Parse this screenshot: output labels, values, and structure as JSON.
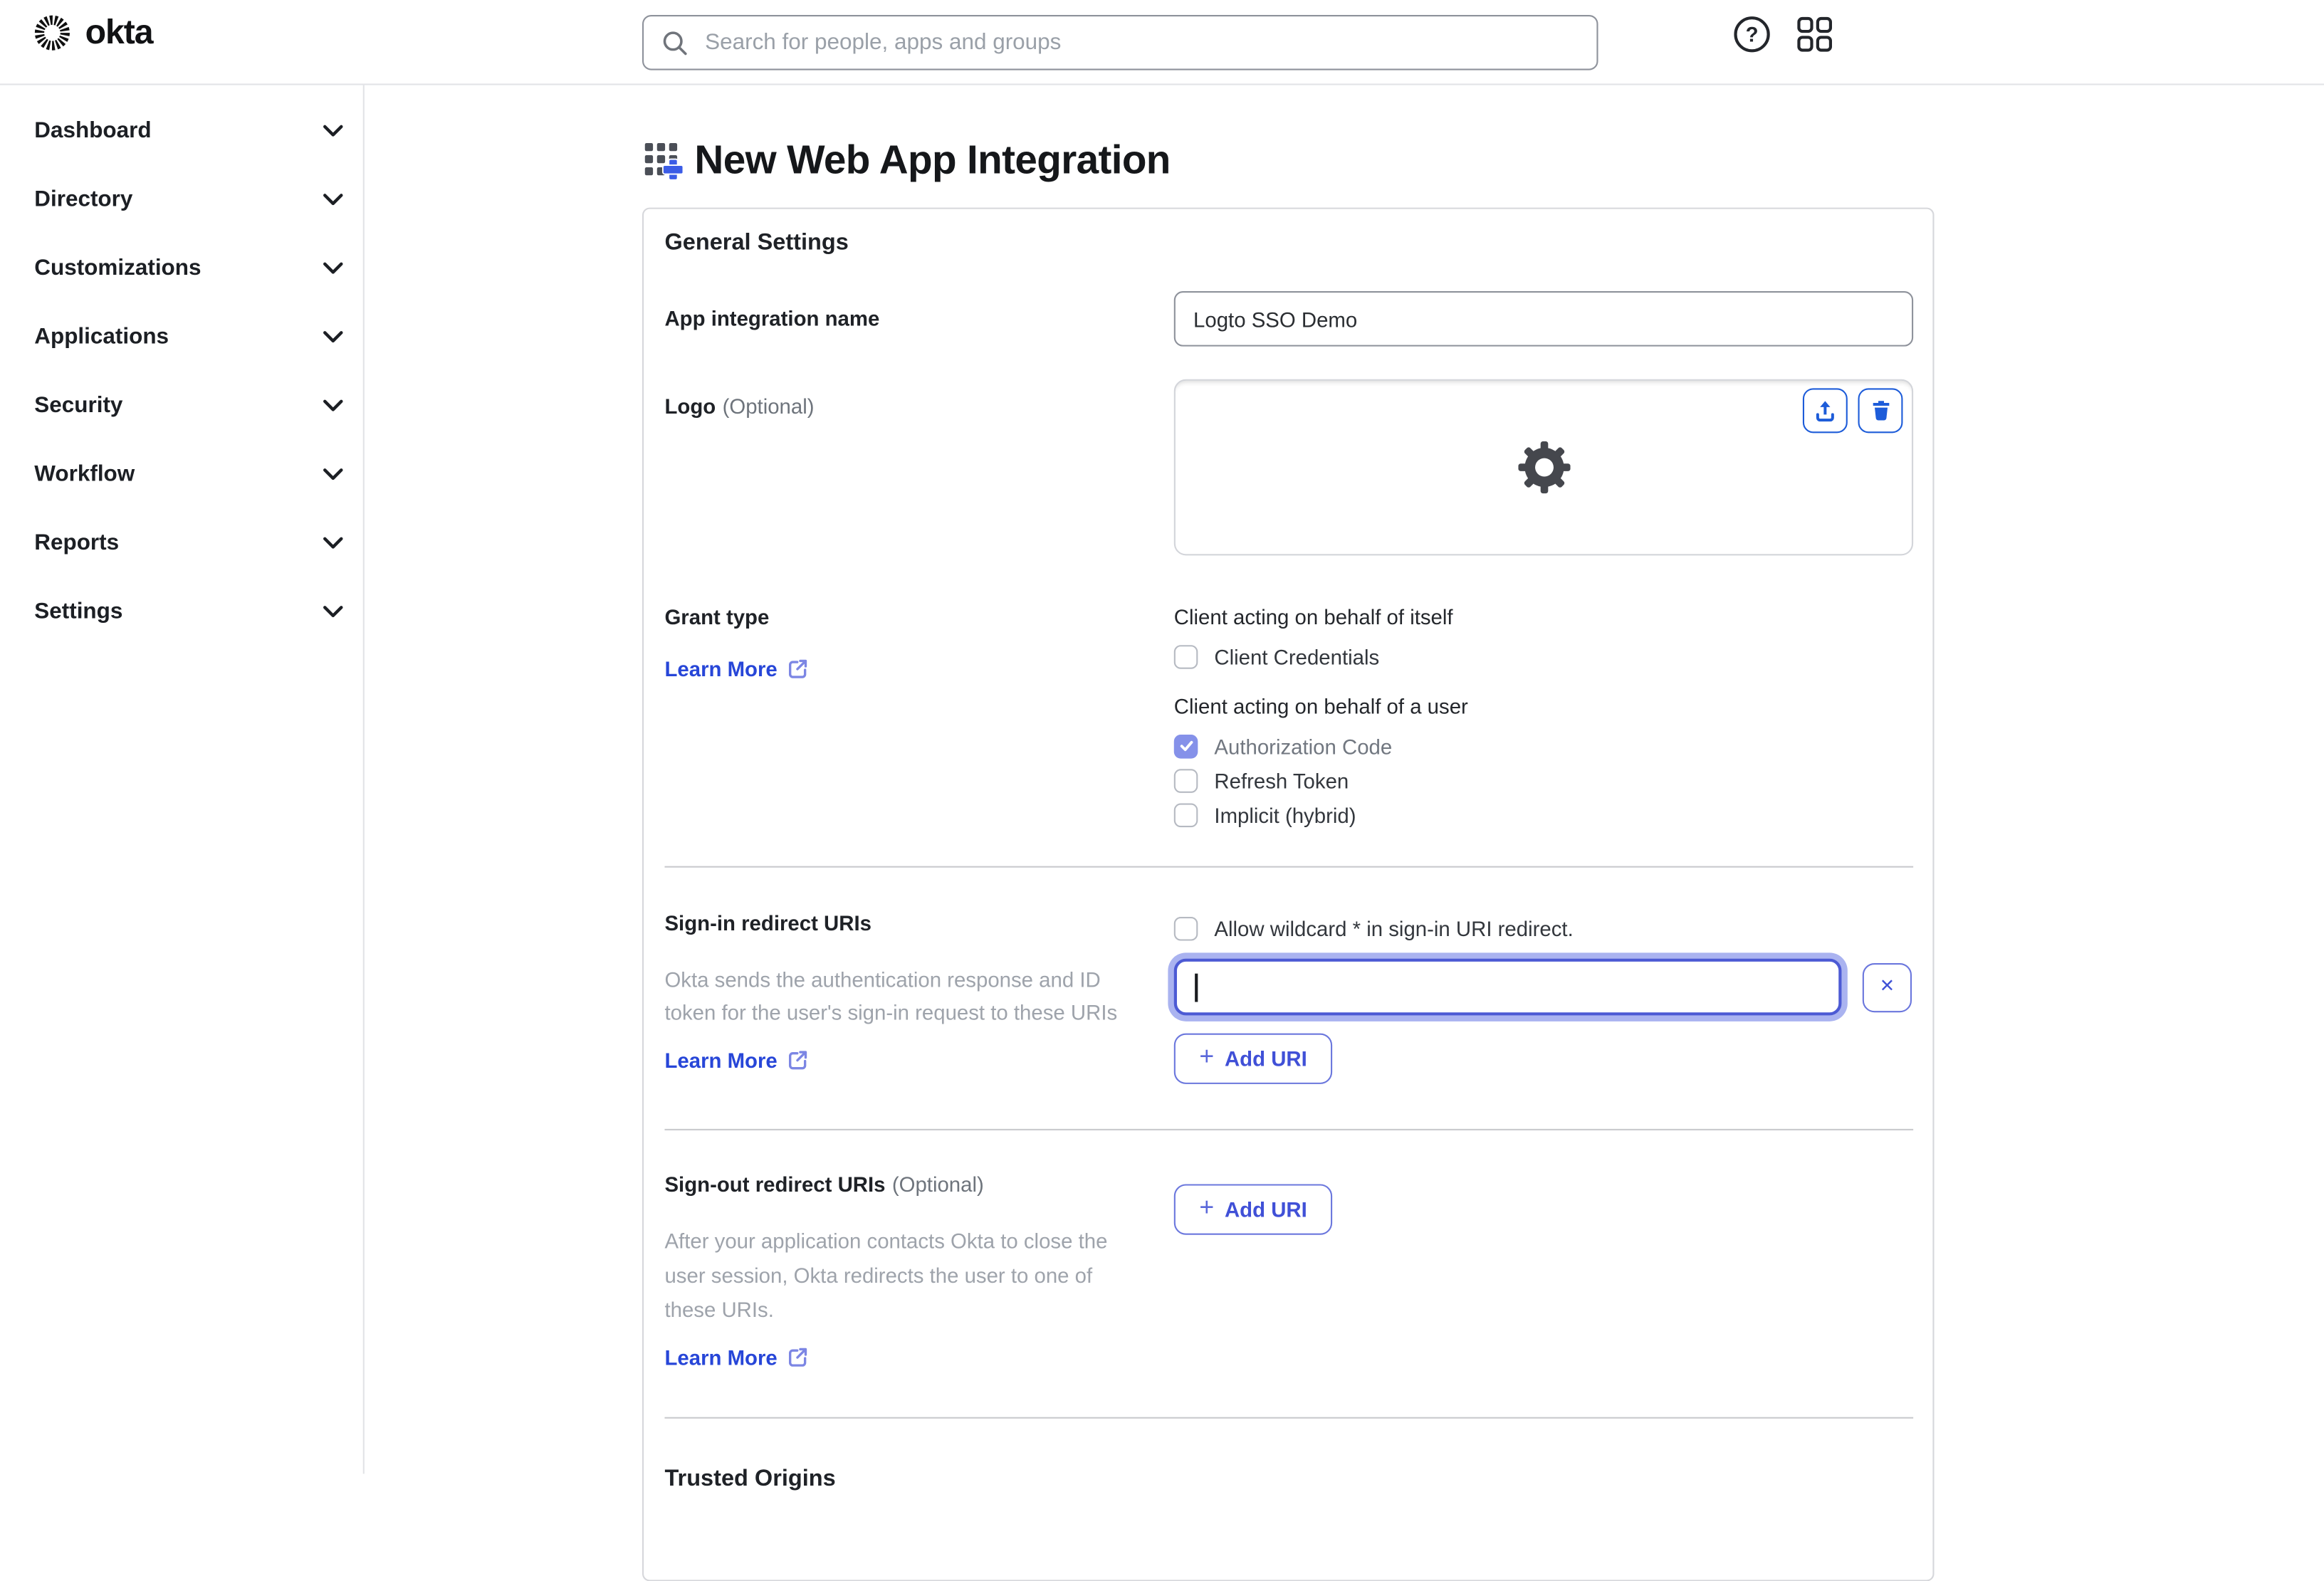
{
  "colors": {
    "link_blue": "#2746d8",
    "button_text_blue": "#4050d7",
    "button_border_blue": "#6b77dd",
    "action_icon_blue": "#1d5cd9",
    "focus_border": "#4c5ad4",
    "focus_ring": "#aab3f0",
    "checkbox_checked_fill": "#8591e9",
    "title_plus_accent": "#3b5ce6"
  },
  "header": {
    "logo_text": "okta",
    "search_placeholder": "Search for people, apps and groups",
    "help_glyph": "?"
  },
  "sidebar": {
    "items": [
      {
        "label": "Dashboard"
      },
      {
        "label": "Directory"
      },
      {
        "label": "Customizations"
      },
      {
        "label": "Applications"
      },
      {
        "label": "Security"
      },
      {
        "label": "Workflow"
      },
      {
        "label": "Reports"
      },
      {
        "label": "Settings"
      }
    ]
  },
  "page": {
    "title": "New Web App Integration"
  },
  "general": {
    "heading": "General Settings",
    "app_name": {
      "label": "App integration name",
      "value": "Logto SSO Demo"
    },
    "logo": {
      "label": "Logo",
      "optional": "(Optional)"
    },
    "grant": {
      "label": "Grant type",
      "learn_more": "Learn More",
      "groups": [
        {
          "label": "Client acting on behalf of itself",
          "options": [
            {
              "label": "Client Credentials",
              "checked": false
            }
          ]
        },
        {
          "label": "Client acting on behalf of a user",
          "options": [
            {
              "label": "Authorization Code",
              "checked": true
            },
            {
              "label": "Refresh Token",
              "checked": false
            },
            {
              "label": "Implicit (hybrid)",
              "checked": false
            }
          ]
        }
      ]
    },
    "signin": {
      "label": "Sign-in redirect URIs",
      "wildcard_label": "Allow wildcard * in sign-in URI redirect.",
      "helper_lines": [
        "Okta sends the authentication response and ID",
        "token for the user's sign-in request to these URIs"
      ],
      "uri_value": "",
      "remove_glyph": "×",
      "plus_glyph": "+",
      "add_uri": "Add URI",
      "learn_more": "Learn More"
    },
    "signout": {
      "label": "Sign-out redirect URIs",
      "optional": "(Optional)",
      "helper_lines": [
        "After your application contacts Okta to close the",
        "user session, Okta redirects the user to one of",
        "these URIs."
      ],
      "plus_glyph": "+",
      "add_uri": "Add URI",
      "learn_more": "Learn More"
    },
    "trusted": {
      "heading": "Trusted Origins"
    }
  }
}
